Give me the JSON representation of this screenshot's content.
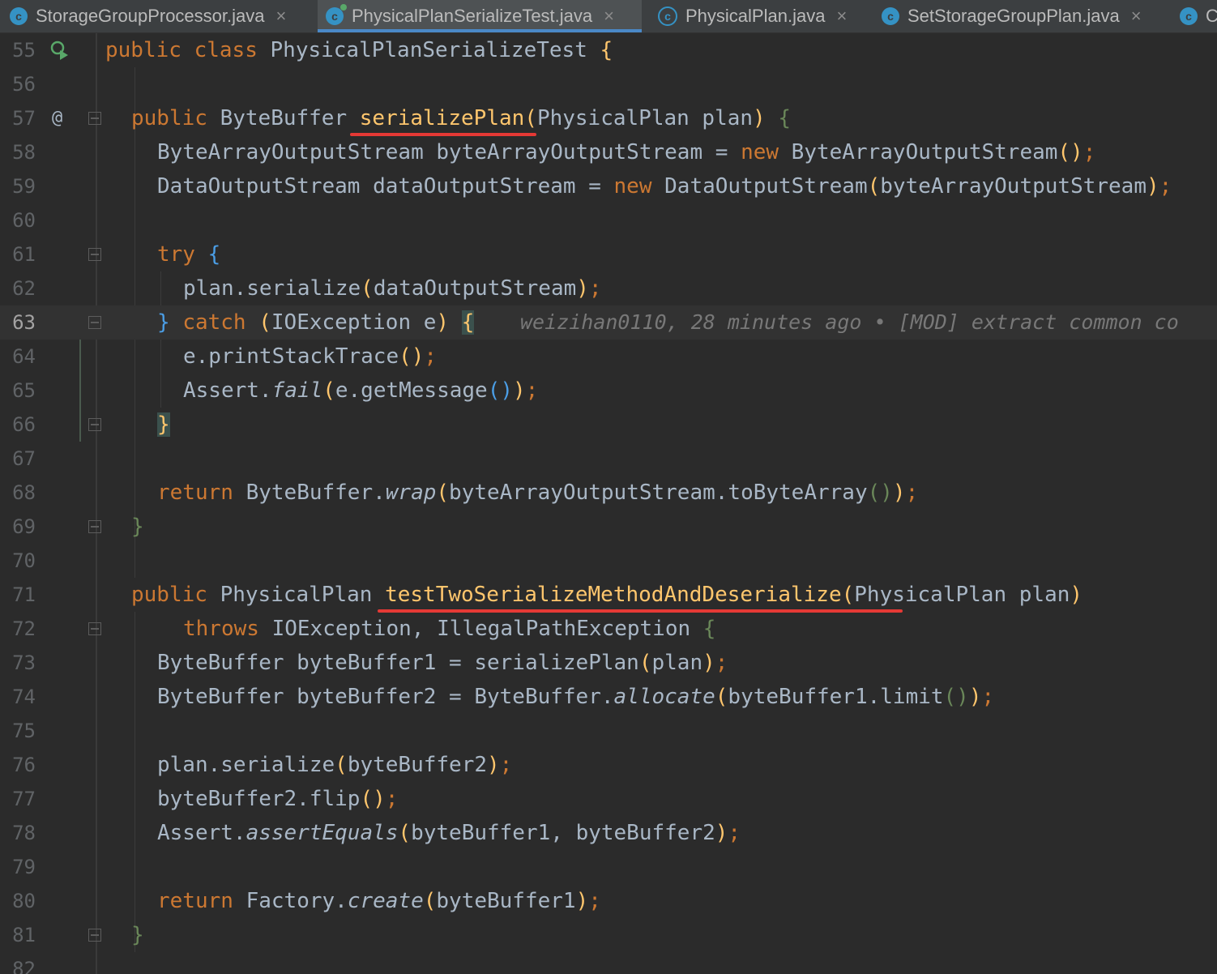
{
  "tabs": [
    {
      "label": "StorageGroupProcessor.java",
      "icon": "class-icon",
      "active": false
    },
    {
      "label": "PhysicalPlanSerializeTest.java",
      "icon": "class-icon",
      "active": true
    },
    {
      "label": "PhysicalPlan.java",
      "icon": "abstract-class-icon",
      "active": false
    },
    {
      "label": "SetStorageGroupPlan.java",
      "icon": "class-icon",
      "active": false
    },
    {
      "label": "C",
      "icon": "class-icon",
      "active": false
    }
  ],
  "tab_close_glyph": "×",
  "tab_icon_letter": "c",
  "gutter": {
    "at_marker": "@",
    "run_icon": "run-test-icon"
  },
  "line_numbers": [
    "55",
    "56",
    "57",
    "58",
    "59",
    "60",
    "61",
    "62",
    "63",
    "64",
    "65",
    "66",
    "67",
    "68",
    "69",
    "70",
    "71",
    "72",
    "73",
    "74",
    "75",
    "76",
    "77",
    "78",
    "79",
    "80",
    "81",
    "82"
  ],
  "current_line": "63",
  "blame_annotation": "weizihan0110, 28 minutes ago • [MOD] extract common co",
  "code": {
    "l55": {
      "kw1": "public",
      "kw2": "class",
      "name": "PhysicalPlanSerializeTest",
      "brace": "{"
    },
    "l57": {
      "kw": "public",
      "type": "ByteBuffer",
      "method": "serializePlan",
      "p1": "(",
      "params": "PhysicalPlan plan",
      "p2": ")",
      "brace": "{"
    },
    "l58": {
      "a": "ByteArrayOutputStream byteArrayOutputStream = ",
      "kw": "new",
      "b": " ByteArrayOutputStream",
      "p": "()",
      "semi": ";"
    },
    "l59": {
      "a": "DataOutputStream dataOutputStream = ",
      "kw": "new",
      "b": " DataOutputStream",
      "p1": "(",
      "arg": "byteArrayOutputStream",
      "p2": ")",
      "semi": ";"
    },
    "l61": {
      "kw": "try",
      "brace": "{"
    },
    "l62": {
      "a": "plan.serialize",
      "p1": "(",
      "arg": "dataOutputStream",
      "p2": ")",
      "semi": ";"
    },
    "l63": {
      "brace1": "}",
      "kw": "catch",
      "p1": "(",
      "arg": "IOException e",
      "p2": ")",
      "brace2": "{"
    },
    "l64": {
      "a": "e.printStackTrace",
      "p": "()",
      "semi": ";"
    },
    "l65": {
      "a": "Assert.",
      "m": "fail",
      "p1": "(",
      "b": "e.getMessage",
      "p": "()",
      "p2": ")",
      "semi": ";"
    },
    "l66": {
      "brace": "}"
    },
    "l68": {
      "kw": "return",
      "a": " ByteBuffer.",
      "m": "wrap",
      "p1": "(",
      "b": "byteArrayOutputStream.toByteArray",
      "p": "()",
      "p2": ")",
      "semi": ";"
    },
    "l69": {
      "brace": "}"
    },
    "l71": {
      "kw": "public",
      "type": "PhysicalPlan",
      "method": "testTwoSerializeMethodAndDeserialize",
      "p1": "(",
      "params": "PhysicalPlan plan",
      "p2": ")"
    },
    "l72": {
      "kw": "throws",
      "a": " IOException, IllegalPathException ",
      "brace": "{"
    },
    "l73": {
      "a": "ByteBuffer byteBuffer1 = serializePlan",
      "p1": "(",
      "arg": "plan",
      "p2": ")",
      "semi": ";"
    },
    "l74": {
      "a": "ByteBuffer byteBuffer2 = ByteBuffer.",
      "m": "allocate",
      "p1": "(",
      "b": "byteBuffer1.limit",
      "p": "()",
      "p2": ")",
      "semi": ";"
    },
    "l76": {
      "a": "plan.serialize",
      "p1": "(",
      "arg": "byteBuffer2",
      "p2": ")",
      "semi": ";"
    },
    "l77": {
      "a": "byteBuffer2.flip",
      "p": "()",
      "semi": ";"
    },
    "l78": {
      "a": "Assert.",
      "m": "assertEquals",
      "p1": "(",
      "arg": "byteBuffer1, byteBuffer2",
      "p2": ")",
      "semi": ";"
    },
    "l80": {
      "kw": "return",
      "a": " Factory.",
      "m": "create",
      "p1": "(",
      "arg": "byteBuffer1",
      "p2": ")",
      "semi": ";"
    },
    "l81": {
      "brace": "}"
    }
  },
  "colors": {
    "background": "#2b2b2b",
    "keyword": "#cc7832",
    "text": "#a9b7c6",
    "method_decl": "#ffc66d",
    "annotation_underline": "#e53935",
    "tab_active_indicator": "#4a88c7"
  }
}
